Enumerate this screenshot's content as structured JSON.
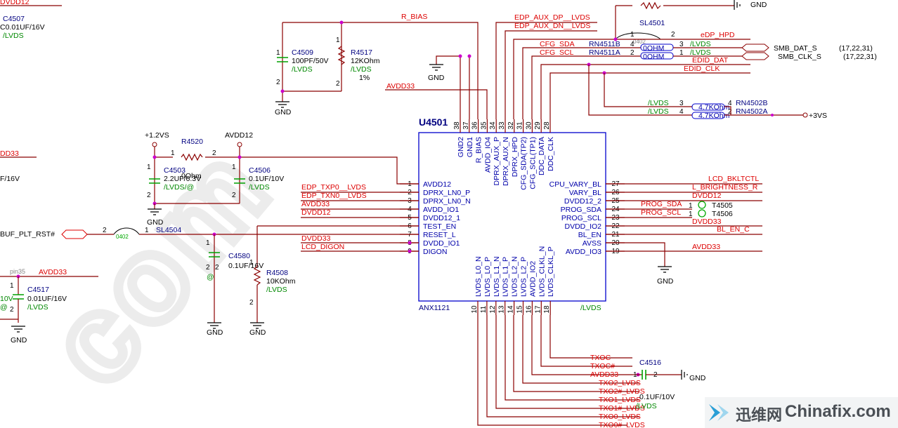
{
  "chip": {
    "ref": "U4501",
    "part": "ANX1121",
    "group": "/LVDS",
    "top_pins": [
      {
        "num": "38",
        "name": "GND2"
      },
      {
        "num": "37",
        "name": "GND1"
      },
      {
        "num": "36",
        "name": "R_BIAS"
      },
      {
        "num": "35",
        "name": "AVDD_IO4"
      },
      {
        "num": "34",
        "name": "DPRX_AUX_P"
      },
      {
        "num": "33",
        "name": "DPRX_AUX_N"
      },
      {
        "num": "32",
        "name": "DPRX_HPD"
      },
      {
        "num": "31",
        "name": "CFG_SDA(TP2)"
      },
      {
        "num": "30",
        "name": "CFG_SCL(TP1)"
      },
      {
        "num": "29",
        "name": "DDC_DATA"
      },
      {
        "num": "28",
        "name": "DDC_CLK"
      }
    ],
    "left_pins": [
      {
        "num": "1",
        "name": "AVDD12"
      },
      {
        "num": "2",
        "name": "DPRX_LN0_P"
      },
      {
        "num": "3",
        "name": "DPRX_LN0_N"
      },
      {
        "num": "4",
        "name": "AVDD_IO1"
      },
      {
        "num": "5",
        "name": "DVDD12_1"
      },
      {
        "num": "6",
        "name": "TEST_EN"
      },
      {
        "num": "7",
        "name": "RESET_L"
      },
      {
        "num": "8",
        "name": "DVDD_IO1"
      },
      {
        "num": "9",
        "name": "DIGON"
      }
    ],
    "right_pins": [
      {
        "num": "27",
        "name": "CPU_VARY_BL"
      },
      {
        "num": "26",
        "name": "VARY_BL"
      },
      {
        "num": "25",
        "name": "DVDD12_2"
      },
      {
        "num": "24",
        "name": "PROG_SDA"
      },
      {
        "num": "23",
        "name": "PROG_SCL"
      },
      {
        "num": "22",
        "name": "DVDD_IO2"
      },
      {
        "num": "21",
        "name": "BL_EN"
      },
      {
        "num": "20",
        "name": "AVSS"
      },
      {
        "num": "19",
        "name": "AVDD_IO3"
      }
    ],
    "bottom_pins": [
      {
        "num": "10",
        "name": "LVDS_L0_N"
      },
      {
        "num": "11",
        "name": "LVDS_L0_P"
      },
      {
        "num": "12",
        "name": "LVDS_L1_N"
      },
      {
        "num": "13",
        "name": "LVDS_L1_P"
      },
      {
        "num": "14",
        "name": "LVDS_L2_N"
      },
      {
        "num": "15",
        "name": "LVDS_L2_P"
      },
      {
        "num": "16",
        "name": "AVDD_IO2"
      },
      {
        "num": "17",
        "name": "LVDS_CLKL_N"
      },
      {
        "num": "18",
        "name": "LVDS_CLKL_P"
      }
    ]
  },
  "nets": {
    "r_bias": "R_BIAS",
    "edp_aux_dp": "EDP_AUX_DP__LVDS",
    "edp_aux_dn": "EDP_AUX_DN__LVDS",
    "edp_hpd": "eDP_HPD",
    "cfg_sda": "CFG_SDA",
    "cfg_scl": "CFG_SCL",
    "edid_dat": "EDID_DAT",
    "edid_clk": "EDID_CLK",
    "avdd33": "AVDD33",
    "avdd12": "AVDD12",
    "p1v2": "+1.2VS",
    "p3v": "+3VS",
    "smb_dat": "SMB_DAT_S",
    "smb_clk": "SMB_CLK_S",
    "smb_dat_ref": "(17,22,31)",
    "smb_clk_ref": "(17,22,31)",
    "edp_txp0": "EDP_TXP0__LVDS",
    "edp_txn0": "EDP_TXN0__LVDS",
    "dvdd12": "DVDD12",
    "dvdd33": "DVDD33",
    "lcd_digon": "LCD_DIGON",
    "buf_plt_rst": "BUF_PLT_RST#",
    "lcd_bkltctl": "LCD_BKLTCTL",
    "l_brightness": "L_BRIGHTNESS_R",
    "prog_sda": "PROG_SDA",
    "prog_scl": "PROG_SCL",
    "bl_en_c": "BL_EN_C",
    "txoc": "TXOC",
    "txoc_n": "TXOC#",
    "txo2": "TXO2_LVDS",
    "txo2_n": "TXO2#_LVDS",
    "txo1": "TXO1_LVDS",
    "txo1_n": "TXO1#_LVDS",
    "txo0": "TXO0_LVDS",
    "txo0_n": "TXO0#_LVDS",
    "gnd": "GND",
    "lvds": "/LVDS",
    "left_dvdd12": "DVDD12",
    "left_dd33": "DD33",
    "left_16v": "F/16V",
    "pin35": "pin35",
    "left_10v": "10V",
    "left_at": "@",
    "ref_1": "1",
    "ref_2": "2"
  },
  "components": {
    "c4509": {
      "ref": "C4509",
      "value": "100PF/50V",
      "group": "/LVDS"
    },
    "r4517": {
      "ref": "R4517",
      "value": "12KOhm",
      "group": "/LVDS",
      "tol": "1%"
    },
    "sl4501": {
      "ref": "SL4501",
      "pkg": "0402"
    },
    "rn4511b": {
      "ref": "RN4511B",
      "value": "0OHM"
    },
    "rn4511a": {
      "ref": "RN4511A",
      "value": "0OHM"
    },
    "rn4502b": {
      "ref": "RN4502B",
      "value": "4.7KOhm"
    },
    "rn4502a": {
      "ref": "RN4502A",
      "value": "4.7KOhm"
    },
    "r4520": {
      "ref": "R4520",
      "value": "0Ohm"
    },
    "c4503": {
      "ref": "C4503",
      "value": "2.2UF/6.3V",
      "group": "/LVDS/@"
    },
    "c4506": {
      "ref": "C4506",
      "value": "0.1UF/10V",
      "group": "/LVDS"
    },
    "sl4504": {
      "ref": "SL4504",
      "pkg": "0402"
    },
    "c4580": {
      "ref": "C4580",
      "value": "0.1UF/16V",
      "group": "@"
    },
    "r4508": {
      "ref": "R4508",
      "value": "10KOhm",
      "group": "/LVDS"
    },
    "c4507": {
      "ref": "C4507",
      "value": "0.01UF/16V",
      "group": "/LVDS"
    },
    "c4517": {
      "ref": "C4517",
      "value": "0.01UF/16V",
      "group": "/LVDS"
    },
    "c4516": {
      "ref": "C4516",
      "value": "0.1UF/10V",
      "group": "/LVDS"
    },
    "t4505": {
      "ref": "T4505"
    },
    "t4506": {
      "ref": "T4506"
    }
  },
  "watermark": {
    "site_cn": "迅维网",
    "site_en": "Chinafix.com",
    "big_text": "com"
  },
  "colors": {
    "wire": "#8b0000",
    "net_label": "#dd0000",
    "chip_outline": "#0000cc",
    "pin_text": "#0000aa",
    "group_text": "#008800",
    "part_text": "#000080",
    "capacitor": "#00aa00"
  }
}
